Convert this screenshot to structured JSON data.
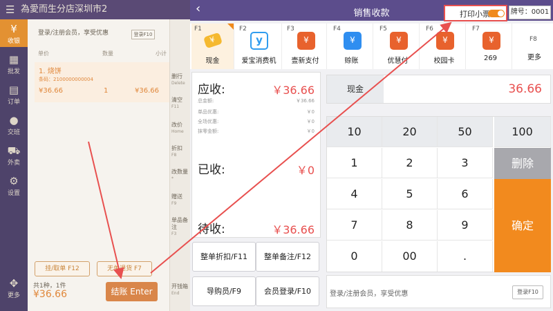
{
  "background": {
    "store_title": "為愛而生分店深圳市2",
    "rail": [
      {
        "label": "收银",
        "icon": "cashier-icon"
      },
      {
        "label": "批发",
        "icon": "wholesale-icon"
      },
      {
        "label": "订单",
        "icon": "order-icon"
      },
      {
        "label": "交班",
        "icon": "shift-icon"
      },
      {
        "label": "外卖",
        "icon": "delivery-icon"
      },
      {
        "label": "设置",
        "icon": "settings-icon"
      },
      {
        "label": "更多",
        "icon": "more-icon"
      }
    ],
    "login_prompt": "登录/注册会员，享受优惠",
    "login_button": "登录F10",
    "columns": {
      "price": "单价",
      "qty": "数量",
      "subtotal": "小计"
    },
    "item": {
      "name": "1. 烧饼",
      "code": "条码：2100000000004",
      "price": "¥36.66",
      "qty": "1",
      "subtotal": "¥36.66"
    },
    "hold_button": "挂/取单 F12",
    "no_code_button": "无单退货 F7",
    "count": "共1种，1件",
    "total": "¥36.66",
    "checkout_button": "结账 Enter",
    "side": [
      {
        "label": "删行",
        "key": "Delete"
      },
      {
        "label": "清空",
        "key": "F11"
      },
      {
        "label": "改价",
        "key": "Home"
      },
      {
        "label": "折扣",
        "key": "F8"
      },
      {
        "label": "改数量",
        "key": "*"
      },
      {
        "label": "赠送",
        "key": "F9"
      },
      {
        "label": "单品备注",
        "key": "F3"
      },
      {
        "label": "开钱箱",
        "key": "End"
      }
    ]
  },
  "dialog": {
    "title": "销售收款",
    "print_receipt_label": "打印小票",
    "print_receipt_on": true,
    "plate_number": "牌号：0001",
    "payment_methods": [
      {
        "key": "F1",
        "label": "现金",
        "icon": "cash-icon",
        "active": true
      },
      {
        "key": "F2",
        "label": "爱宝消费机",
        "icon": "aibao-icon",
        "active": false
      },
      {
        "key": "F3",
        "label": "壹新支付",
        "icon": "wallet-icon",
        "active": false
      },
      {
        "key": "F4",
        "label": "赊账",
        "icon": "credit-icon",
        "active": false
      },
      {
        "key": "F5",
        "label": "优慧付",
        "icon": "wallet-icon",
        "active": false
      },
      {
        "key": "F6",
        "label": "校园卡",
        "icon": "wallet-icon",
        "active": false
      },
      {
        "key": "F7",
        "label": "269",
        "icon": "wallet-icon",
        "active": false
      },
      {
        "key": "F8",
        "label": "更多",
        "icon": "more-icon",
        "active": false
      }
    ],
    "summary": {
      "due_label": "应收:",
      "due_value": "￥36.66",
      "details": [
        {
          "label": "总金额:",
          "value": "￥36.66"
        },
        {
          "label": "单品优惠:",
          "value": "￥0"
        },
        {
          "label": "全场优惠:",
          "value": "￥0"
        },
        {
          "label": "抹零金额:",
          "value": "￥0"
        }
      ],
      "paid_label": "已收:",
      "paid_value": "￥0",
      "remaining_label": "待收:",
      "remaining_value": "￥36.66"
    },
    "selected_method": {
      "label": "现金",
      "amount": "36.66"
    },
    "keypad": {
      "keys": [
        "10",
        "20",
        "50",
        "100",
        "1",
        "2",
        "3",
        "4",
        "5",
        "6",
        "7",
        "8",
        "9",
        "0",
        "00",
        "."
      ],
      "delete": "删除",
      "confirm": "确定"
    },
    "function_buttons": [
      "整单折扣/F11",
      "整单备注/F12",
      "导购员/F9",
      "会员登录/F10"
    ],
    "member_bar": {
      "text": "登录/注册会员，享受优惠",
      "button": "登录F10"
    }
  },
  "colors": {
    "header": "#5c4d8c",
    "accent": "#f28a1e",
    "amount": "#e8504f",
    "highlight_box": "#e8504f"
  }
}
